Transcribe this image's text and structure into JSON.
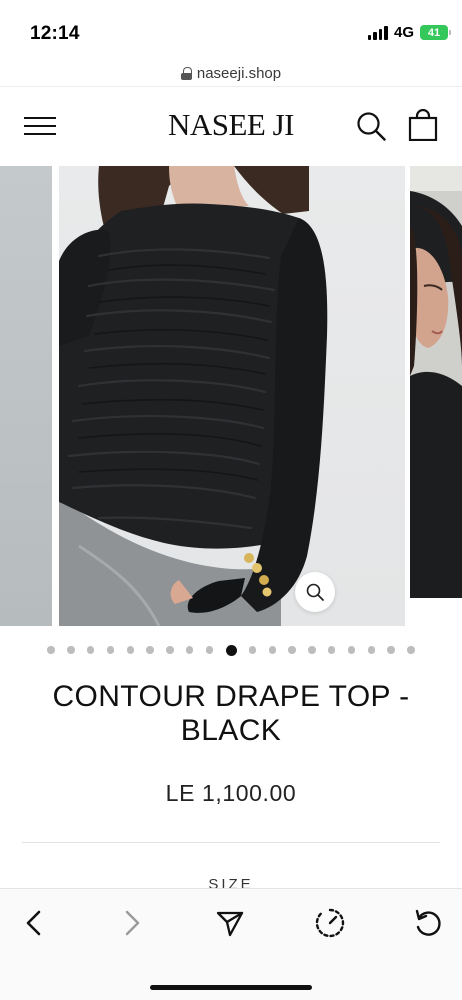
{
  "status_bar": {
    "time": "12:14",
    "network": "4G",
    "battery": "41"
  },
  "url_bar": {
    "url": "naseeji.shop"
  },
  "header": {
    "brand": "NASEE JI",
    "icons": [
      "menu-icon",
      "search-icon",
      "shopping-bag-icon"
    ]
  },
  "gallery": {
    "dot_count": 19,
    "active_dot_index": 9,
    "zoom_icon": "zoom-icon"
  },
  "product": {
    "title": "CONTOUR DRAPE TOP - BLACK",
    "price": "LE 1,100.00",
    "size_label": "SIZE"
  },
  "toolbar": {
    "icons": [
      "back-icon",
      "forward-icon",
      "share-icon",
      "speed-icon",
      "reload-icon"
    ]
  },
  "colors": {
    "accent": "#111111",
    "battery": "#34c759",
    "inactive_dot": "#bdbdbd"
  }
}
